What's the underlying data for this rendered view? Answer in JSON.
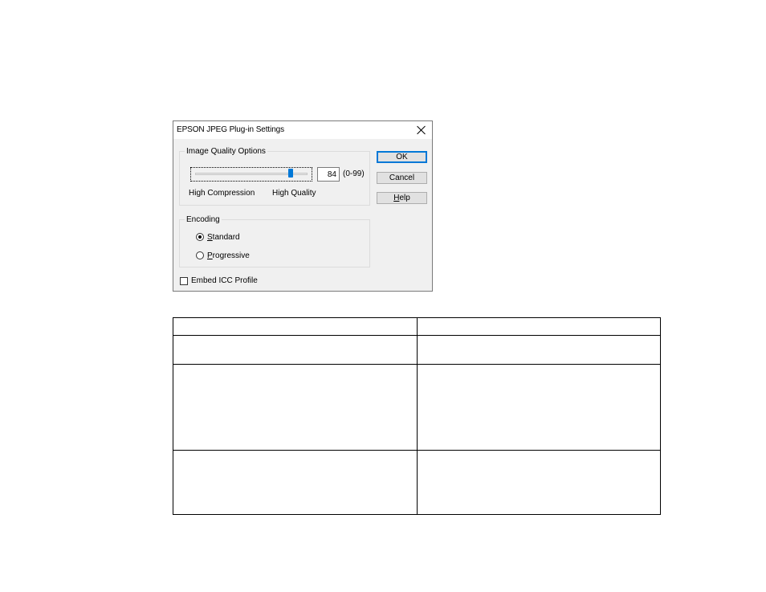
{
  "dialog": {
    "title": "EPSON JPEG Plug-in Settings",
    "image_quality": {
      "legend": "Image Quality Options",
      "slider_value": 84,
      "slider_min": 0,
      "slider_max": 99,
      "value_text": "84",
      "range_text": "(0-99)",
      "low_label": "High Compression",
      "high_label": "High Quality"
    },
    "encoding": {
      "legend": "Encoding",
      "options": [
        {
          "mnemonic": "S",
          "rest": "tandard",
          "checked": true
        },
        {
          "mnemonic": "P",
          "rest": "rogressive",
          "checked": false
        }
      ]
    },
    "embed_icc": {
      "label": "Embed ICC Profile",
      "checked": false
    },
    "buttons": {
      "ok": "OK",
      "cancel": "Cancel",
      "help_mnemonic": "H",
      "help_rest": "elp"
    }
  },
  "colors": {
    "accent": "#0078d7",
    "dialog_bg": "#f0f0f0"
  }
}
